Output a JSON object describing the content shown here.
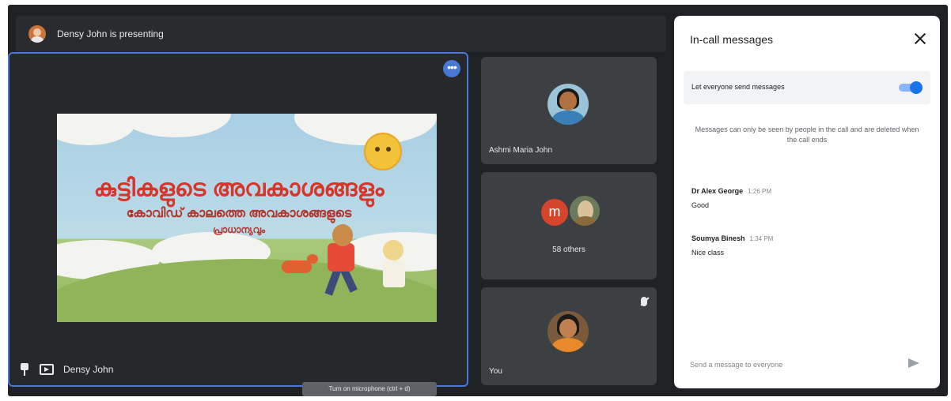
{
  "header": {
    "presenting_text": "Densy John is presenting"
  },
  "main_tile": {
    "name": "Densy John",
    "slide": {
      "title": "കുട്ടികളുടെ അവകാശങ്ങളും",
      "subtitle": "കോവിഡ് കാലത്തെ അവകാശങ്ങളുടെ",
      "subtitle2": "പ്രാധാന്യവും"
    }
  },
  "participants": [
    {
      "name": "Ashmi Maria John"
    },
    {
      "name": "58 others",
      "initial": "m"
    },
    {
      "name": "You"
    }
  ],
  "tooltip": "Turn on microphone (ctrl + d)",
  "chat": {
    "title": "In-call messages",
    "toggle_label": "Let everyone send messages",
    "toggle_on": true,
    "info": "Messages can only be seen by people in the call and are deleted when the call ends",
    "messages": [
      {
        "sender": "Dr Alex George",
        "time": "1:26 PM",
        "text": "Good"
      },
      {
        "sender": "Soumya Binesh",
        "time": "1:34 PM",
        "text": "Nice class"
      }
    ],
    "compose_placeholder": "Send a message to everyone"
  },
  "colors": {
    "accent": "#1a73e8",
    "tile_border": "#4a78d6",
    "background": "#202124",
    "tile": "#3c4043"
  },
  "icons": [
    "more-options-icon",
    "pin-icon",
    "present-screen-icon",
    "mic-off-icon",
    "close-icon",
    "send-icon"
  ]
}
